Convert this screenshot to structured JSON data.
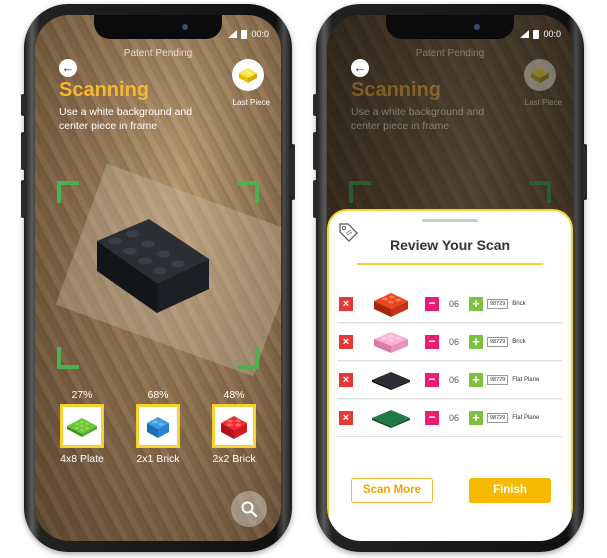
{
  "status_bar": {
    "time": "00:0"
  },
  "scanning_screen": {
    "patent_text": "Patent Pending",
    "title": "Scanning",
    "instructions": "Use a white background and center piece in frame",
    "last_piece_label": "Last Piece",
    "candidates": [
      {
        "percent": "27%",
        "name": "4x8 Plate",
        "color": "#5cb82e"
      },
      {
        "percent": "68%",
        "name": "2x1 Brick",
        "color": "#2f8bd6"
      },
      {
        "percent": "48%",
        "name": "2x2 Brick",
        "color": "#e0202a"
      }
    ]
  },
  "review_screen": {
    "title": "Review Your Scan",
    "rows": [
      {
        "quantity": "06",
        "part_number": "98729",
        "type": "Brick",
        "color": "#d93a1c"
      },
      {
        "quantity": "06",
        "part_number": "98729",
        "type": "Brick",
        "color": "#f19ac6"
      },
      {
        "quantity": "06",
        "part_number": "98729",
        "type": "Flat Plane",
        "color": "#1e2126"
      },
      {
        "quantity": "06",
        "part_number": "98729",
        "type": "Flat Plane",
        "color": "#1d6b3a"
      }
    ],
    "scan_more_label": "Scan More",
    "finish_label": "Finish"
  },
  "colors": {
    "accent": "#f7b731",
    "frame": "#4caf50",
    "remove": "#e53935",
    "minus": "#e91e73",
    "plus": "#7cc242"
  }
}
